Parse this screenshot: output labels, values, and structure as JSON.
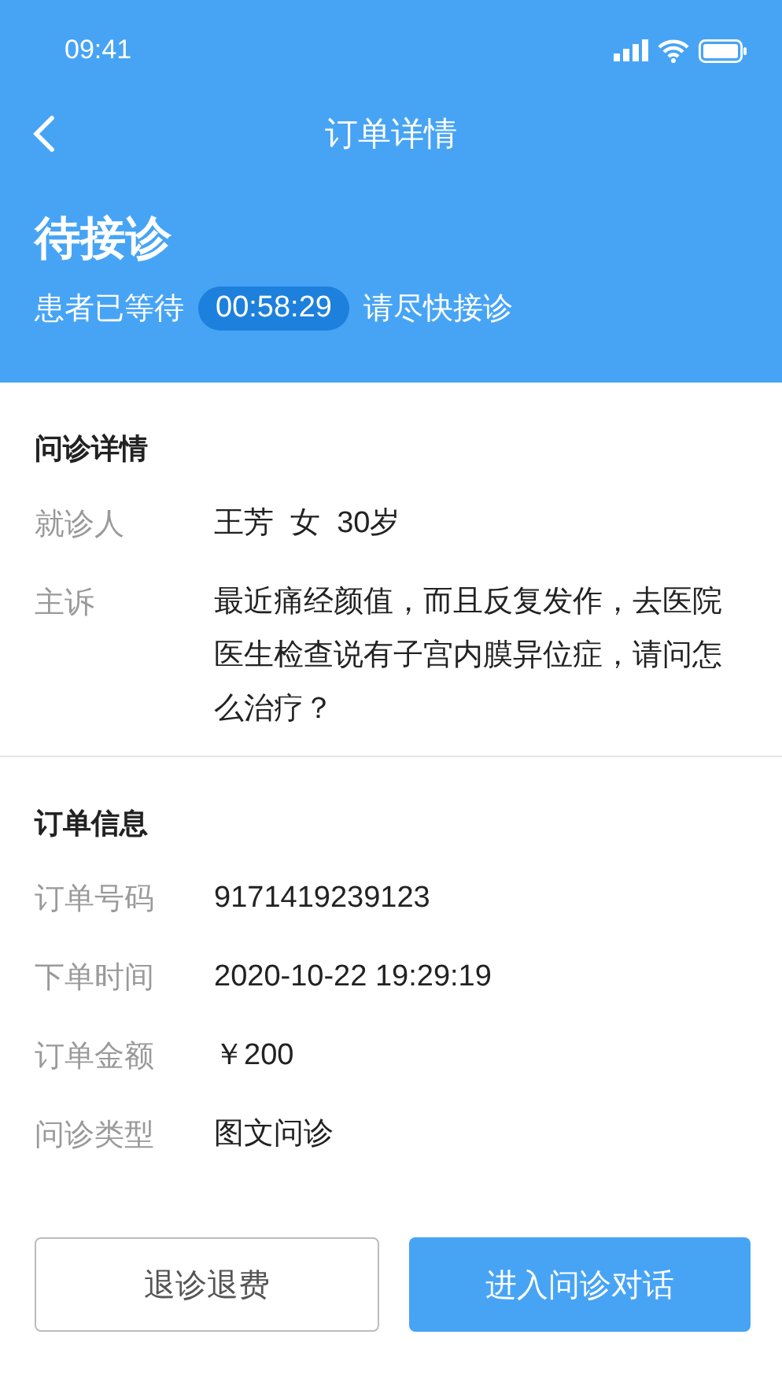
{
  "status_bar": {
    "time": "09:41"
  },
  "nav": {
    "title": "订单详情"
  },
  "header": {
    "status": "待接诊",
    "wait_label": "患者已等待",
    "timer": "00:58:29",
    "wait_hint": "请尽快接诊"
  },
  "sections": [
    {
      "title": "问诊详情",
      "rows": [
        {
          "label": "就诊人",
          "value": "王芳  女  30岁"
        },
        {
          "label": "主诉",
          "value": "最近痛经颜值，而且反复发作，去医院医生检查说有子宫内膜异位症，请问怎么治疗？"
        }
      ]
    },
    {
      "title": "订单信息",
      "rows": [
        {
          "label": "订单号码",
          "value": "9171419239123"
        },
        {
          "label": "下单时间",
          "value": "2020-10-22 19:29:19"
        },
        {
          "label": "订单金额",
          "value": "￥200"
        },
        {
          "label": "问诊类型",
          "value": "图文问诊"
        }
      ]
    }
  ],
  "buttons": [
    {
      "label": "退诊退费",
      "kind": "secondary"
    },
    {
      "label": "进入问诊对话",
      "kind": "primary"
    }
  ]
}
